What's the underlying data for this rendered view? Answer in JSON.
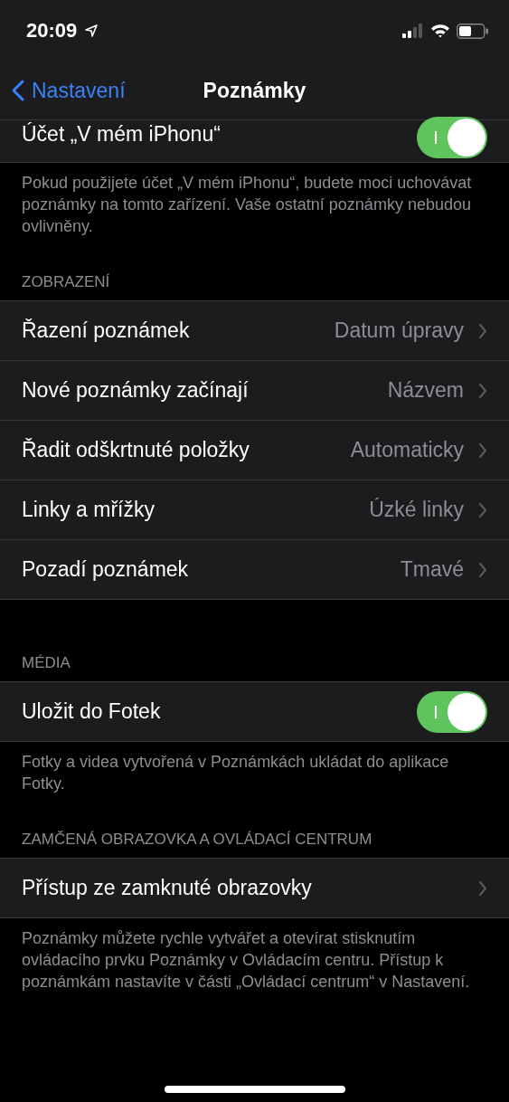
{
  "status_bar": {
    "time": "20:09"
  },
  "nav": {
    "back": "Nastavení",
    "title": "Poznámky"
  },
  "sections": [
    {
      "rows": [
        {
          "kind": "toggle",
          "label": "Účet „V mém iPhonu“",
          "on": true
        }
      ],
      "footer": "Pokud použijete účet „V mém iPhonu“, budete moci uchovávat poznámky na tomto zařízení. Vaše ostatní poznámky nebudou ovlivněny."
    },
    {
      "header": "ZOBRAZENÍ",
      "rows": [
        {
          "kind": "link",
          "label": "Řazení poznámek",
          "value": "Datum úpravy"
        },
        {
          "kind": "link",
          "label": "Nové poznámky začínají",
          "value": "Názvem"
        },
        {
          "kind": "link",
          "label": "Řadit odškrtnuté položky",
          "value": "Automaticky"
        },
        {
          "kind": "link",
          "label": "Linky a mřížky",
          "value": "Úzké linky"
        },
        {
          "kind": "link",
          "label": "Pozadí poznámek",
          "value": "Tmavé"
        }
      ]
    },
    {
      "header": "MÉDIA",
      "rows": [
        {
          "kind": "toggle",
          "label": "Uložit do Fotek",
          "on": true
        }
      ],
      "footer": "Fotky a videa vytvořená v Poznámkách ukládat do aplikace Fotky."
    },
    {
      "header": "ZAMČENÁ OBRAZOVKA A OVLÁDACÍ CENTRUM",
      "rows": [
        {
          "kind": "link",
          "label": "Přístup ze zamknuté obrazovky"
        }
      ],
      "footer": "Poznámky můžete rychle vytvářet a otevírat stisknutím ovládacího prvku Poznámky v Ovládacím centru. Přístup k poznámkám nastavíte v části „Ovládací centrum“ v Nastavení."
    }
  ]
}
